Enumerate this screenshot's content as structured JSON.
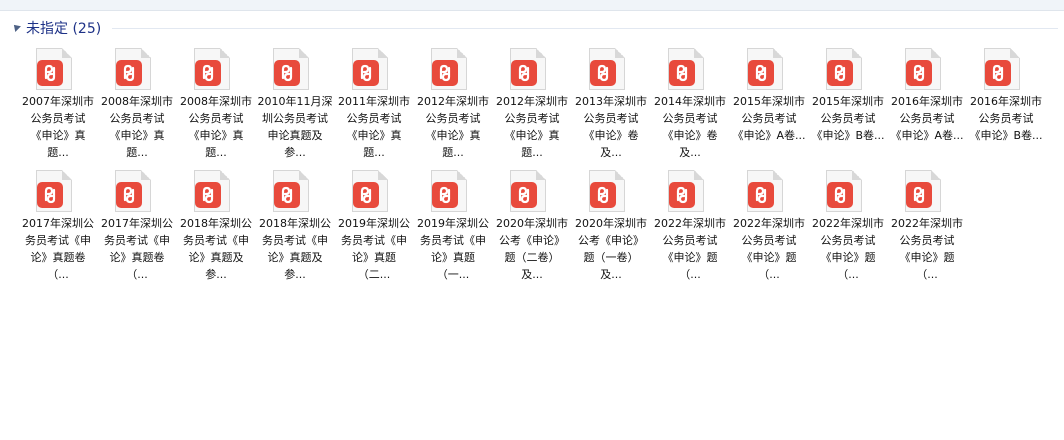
{
  "group": {
    "title": "未指定 (25)"
  },
  "files": [
    {
      "name": "2007年深圳市公务员考试《申论》真题...",
      "icon": "pdf-icon"
    },
    {
      "name": "2008年深圳市公务员考试《申论》真题...",
      "icon": "pdf-icon"
    },
    {
      "name": "2008年深圳市公务员考试《申论》真题...",
      "icon": "pdf-icon"
    },
    {
      "name": "2010年11月深圳公务员考试申论真题及参...",
      "icon": "pdf-icon"
    },
    {
      "name": "2011年深圳市公务员考试《申论》真题...",
      "icon": "pdf-icon"
    },
    {
      "name": "2012年深圳市公务员考试《申论》真题...",
      "icon": "pdf-icon"
    },
    {
      "name": "2012年深圳市公务员考试《申论》真题...",
      "icon": "pdf-icon"
    },
    {
      "name": "2013年深圳市公务员考试《申论》卷及...",
      "icon": "pdf-icon"
    },
    {
      "name": "2014年深圳市公务员考试《申论》卷及...",
      "icon": "pdf-icon"
    },
    {
      "name": "2015年深圳市公务员考试《申论》A卷...",
      "icon": "pdf-icon"
    },
    {
      "name": "2015年深圳市公务员考试《申论》B卷...",
      "icon": "pdf-icon"
    },
    {
      "name": "2016年深圳市公务员考试《申论》A卷...",
      "icon": "pdf-icon"
    },
    {
      "name": "2016年深圳市公务员考试《申论》B卷...",
      "icon": "pdf-icon"
    },
    {
      "name": "2017年深圳公务员考试《申论》真题卷（...",
      "icon": "pdf-icon"
    },
    {
      "name": "2017年深圳公务员考试《申论》真题卷（...",
      "icon": "pdf-icon"
    },
    {
      "name": "2018年深圳公务员考试《申论》真题及参...",
      "icon": "pdf-icon"
    },
    {
      "name": "2018年深圳公务员考试《申论》真题及参...",
      "icon": "pdf-icon"
    },
    {
      "name": "2019年深圳公务员考试《申论》真题（二...",
      "icon": "pdf-icon"
    },
    {
      "name": "2019年深圳公务员考试《申论》真题（一...",
      "icon": "pdf-icon"
    },
    {
      "name": "2020年深圳市公考《申论》题（二卷）及...",
      "icon": "pdf-icon"
    },
    {
      "name": "2020年深圳市公考《申论》题（一卷）及...",
      "icon": "pdf-icon"
    },
    {
      "name": "2022年深圳市公务员考试《申论》题（...",
      "icon": "pdf-icon"
    },
    {
      "name": "2022年深圳市公务员考试《申论》题（...",
      "icon": "pdf-icon"
    },
    {
      "name": "2022年深圳市公务员考试《申论》题（...",
      "icon": "pdf-icon"
    },
    {
      "name": "2022年深圳市公务员考试《申论》题（...",
      "icon": "pdf-icon"
    }
  ],
  "colors": {
    "group_title": "#1e3287",
    "pdf_badge": "#e84a3c"
  }
}
